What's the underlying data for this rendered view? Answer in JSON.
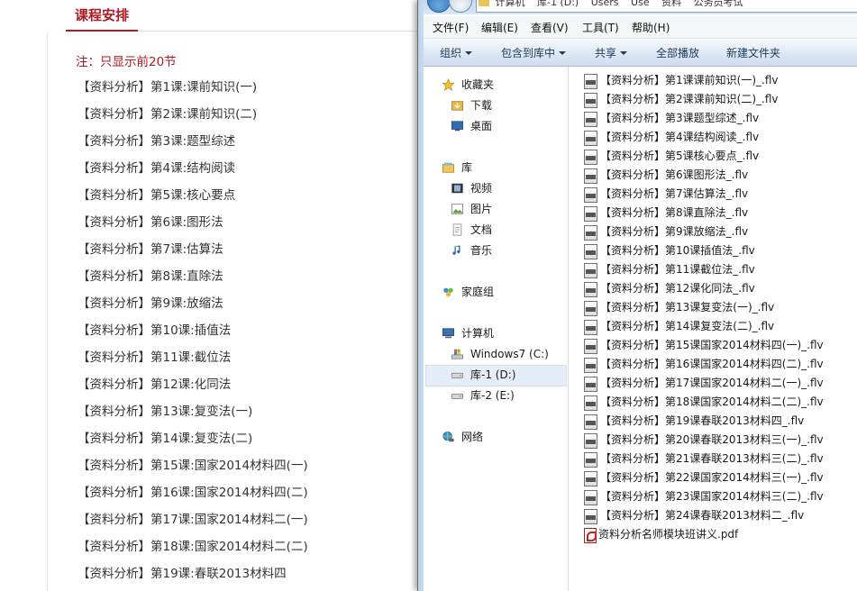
{
  "web": {
    "tab_title": "课程安排",
    "note": "注：只显示前20节",
    "lessons": [
      "【资料分析】第1课:课前知识(一)",
      "【资料分析】第2课:课前知识(二)",
      "【资料分析】第3课:题型综述",
      "【资料分析】第4课:结构阅读",
      "【资料分析】第5课:核心要点",
      "【资料分析】第6课:图形法",
      "【资料分析】第7课:估算法",
      "【资料分析】第8课:直除法",
      "【资料分析】第9课:放缩法",
      "【资料分析】第10课:插值法",
      "【资料分析】第11课:截位法",
      "【资料分析】第12课:化同法",
      "【资料分析】第13课:复变法(一)",
      "【资料分析】第14课:复变法(二)",
      "【资料分析】第15课:国家2014材料四(一)",
      "【资料分析】第16课:国家2014材料四(二)",
      "【资料分析】第17课:国家2014材料二(一)",
      "【资料分析】第18课:国家2014材料二(二)",
      "【资料分析】第19课:春联2013材料四"
    ]
  },
  "explorer": {
    "address_segments": [
      "计算机",
      "库-1 (D:)",
      "Users",
      "Use",
      "资料",
      "公务员考试"
    ],
    "menu": [
      "文件(F)",
      "编辑(E)",
      "查看(V)",
      "工具(T)",
      "帮助(H)"
    ],
    "toolbar": [
      "组织",
      "包含到库中",
      "共享",
      "全部播放",
      "新建文件夹"
    ],
    "nav": {
      "favorites": "收藏夹",
      "downloads": "下载",
      "desktop": "桌面",
      "libraries": "库",
      "videos": "视频",
      "pictures": "图片",
      "documents": "文档",
      "music": "音乐",
      "homegroup": "家庭组",
      "computer": "计算机",
      "drive_c": "Windows7 (C:)",
      "drive_d": "库-1 (D:)",
      "drive_e": "库-2 (E:)",
      "network": "网络"
    },
    "files": [
      "【资料分析】第1课课前知识(一)_.flv",
      "【资料分析】第2课课前知识(二)_.flv",
      "【资料分析】第3课题型综述_.flv",
      "【资料分析】第4课结构阅读_.flv",
      "【资料分析】第5课核心要点_.flv",
      "【资料分析】第6课图形法_.flv",
      "【资料分析】第7课估算法_.flv",
      "【资料分析】第8课直除法_.flv",
      "【资料分析】第9课放缩法_.flv",
      "【资料分析】第10课插值法_.flv",
      "【资料分析】第11课截位法_.flv",
      "【资料分析】第12课化同法_.flv",
      "【资料分析】第13课复变法(一)_.flv",
      "【资料分析】第14课复变法(二)_.flv",
      "【资料分析】第15课国家2014材料四(一)_.flv",
      "【资料分析】第16课国家2014材料四(二)_.flv",
      "【资料分析】第17课国家2014材料二(一)_.flv",
      "【资料分析】第18课国家2014材料二(二)_.flv",
      "【资料分析】第19课春联2013材料四_.flv",
      "【资料分析】第20课春联2013材料三(一)_.flv",
      "【资料分析】第21课春联2013材料三(二)_.flv",
      "【资料分析】第22课国家2014材料三(一)_.flv",
      "【资料分析】第23课国家2014材料三(二)_.flv",
      "【资料分析】第24课春联2013材料二_.flv"
    ],
    "pdf_file": "资料分析名师模块班讲义.pdf"
  }
}
